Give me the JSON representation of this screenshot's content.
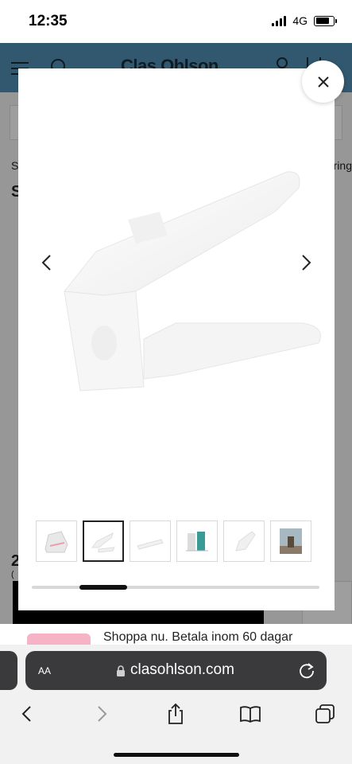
{
  "status_bar": {
    "time": "12:35",
    "network": "4G",
    "battery_level": 0.8
  },
  "site": {
    "brand": "Clas Ohlson",
    "crumb_left": "S",
    "crumb_right": "ring",
    "title_fragment": "S",
    "price_fragment": "2",
    "small_fragment": "(",
    "header_color": "#4f8fb4"
  },
  "gallery": {
    "current_index": 2,
    "total_images": 6,
    "thumbnails": [
      {
        "name": "thumbnail-shoe-rack-with-shoe"
      },
      {
        "name": "thumbnail-shoe-rack-side"
      },
      {
        "name": "thumbnail-shoe-rack-flat"
      },
      {
        "name": "thumbnail-shoe-rack-with-sneakers"
      },
      {
        "name": "thumbnail-shoe-rack-angle"
      },
      {
        "name": "thumbnail-lifestyle-photo"
      }
    ]
  },
  "promo": {
    "text": "Shoppa nu. Betala inom 60 dagar"
  },
  "browser": {
    "aa_label": "AA",
    "url": "clasohlson.com"
  }
}
